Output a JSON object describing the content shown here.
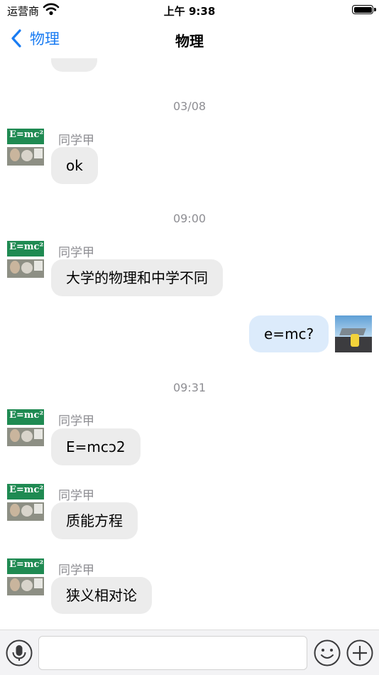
{
  "status_bar": {
    "carrier": "运营商",
    "time": "上午 9:38"
  },
  "nav": {
    "back_label": "物理",
    "title": "物理"
  },
  "messages": [
    {
      "time": "03/08",
      "sender": "同学甲",
      "text": "ok"
    },
    {
      "time": "09:00",
      "sender": "同学甲",
      "text": "大学的物理和中学不同"
    },
    {
      "sender": "me",
      "text": "e=mc?"
    },
    {
      "time": "09:31",
      "sender": "同学甲",
      "text": "E=mcↄ2"
    },
    {
      "sender": "同学甲",
      "text": "质能方程"
    },
    {
      "sender": "同学甲",
      "text": "狭义相对论"
    }
  ],
  "avatar_text": "E=mc²",
  "input": {
    "placeholder": ""
  },
  "icons": [
    "back-chevron-icon",
    "wifi-icon",
    "battery-icon",
    "voice-icon",
    "emoji-icon",
    "add-icon"
  ]
}
